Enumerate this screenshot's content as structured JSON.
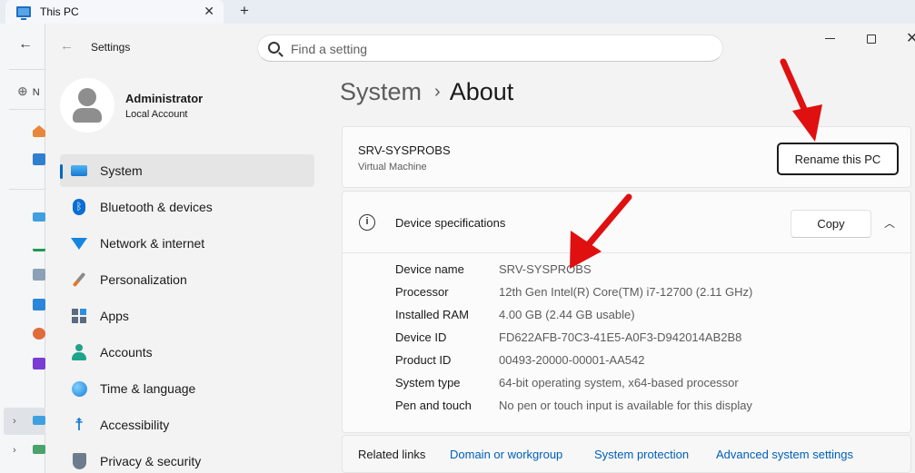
{
  "explorer": {
    "tab_title": "This PC",
    "tab_close": "✕",
    "new_tab": "+",
    "back": "←",
    "new_button": "⊕",
    "new_label": "N"
  },
  "settings": {
    "app_title": "Settings",
    "back": "←",
    "search": {
      "placeholder": "Find a setting",
      "value": ""
    },
    "window_controls": {
      "close": "✕"
    },
    "user": {
      "name": "Administrator",
      "account_type": "Local Account"
    },
    "nav": [
      {
        "label": "System",
        "icon": "monitor-icon",
        "active": true
      },
      {
        "label": "Bluetooth & devices",
        "icon": "bluetooth-icon"
      },
      {
        "label": "Network & internet",
        "icon": "wifi-icon"
      },
      {
        "label": "Personalization",
        "icon": "brush-icon"
      },
      {
        "label": "Apps",
        "icon": "apps-icon"
      },
      {
        "label": "Accounts",
        "icon": "person-icon"
      },
      {
        "label": "Time & language",
        "icon": "globe-clock-icon"
      },
      {
        "label": "Accessibility",
        "icon": "accessibility-icon"
      },
      {
        "label": "Privacy & security",
        "icon": "shield-icon"
      }
    ],
    "breadcrumb": {
      "parent": "System",
      "separator": "›",
      "current": "About"
    },
    "pc": {
      "name": "SRV-SYSPROBS",
      "type": "Virtual Machine",
      "rename_label": "Rename this PC"
    },
    "specs": {
      "title": "Device specifications",
      "copy_label": "Copy",
      "collapse": "︿",
      "rows": [
        {
          "key": "Device name",
          "value": "SRV-SYSPROBS"
        },
        {
          "key": "Processor",
          "value": "12th Gen Intel(R) Core(TM) i7-12700 (2.11 GHz)"
        },
        {
          "key": "Installed RAM",
          "value": "4.00 GB (2.44 GB usable)"
        },
        {
          "key": "Device ID",
          "value": "FD622AFB-70C3-41E5-A0F3-D942014AB2B8"
        },
        {
          "key": "Product ID",
          "value": "00493-20000-00001-AA542"
        },
        {
          "key": "System type",
          "value": "64-bit operating system, x64-based processor"
        },
        {
          "key": "Pen and touch",
          "value": "No pen or touch input is available for this display"
        }
      ]
    },
    "related": {
      "title": "Related links",
      "links": [
        "Domain or workgroup",
        "System protection",
        "Advanced system settings"
      ]
    }
  },
  "annotation": {
    "arrow_color": "#e01010"
  }
}
